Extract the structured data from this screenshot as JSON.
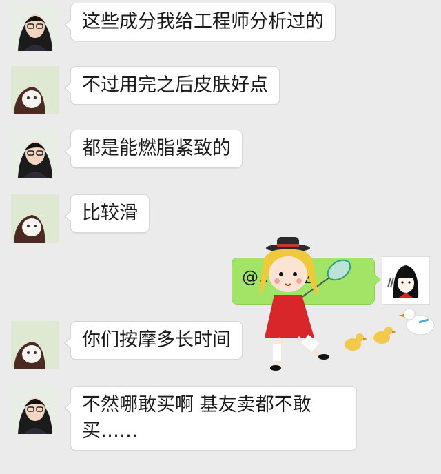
{
  "messages": [
    {
      "sender": "girl-glasses",
      "text": "这些成分我给工程师分析过的"
    },
    {
      "sender": "girl-mask",
      "text": "不过用完之后皮肤好点"
    },
    {
      "sender": "girl-glasses",
      "text": "都是能燃脂紧致的"
    },
    {
      "sender": "girl-mask",
      "text": "比较滑"
    },
    {
      "sender": "self",
      "text": "@... 专业"
    },
    {
      "sender": "girl-mask",
      "text": "你们按摩多长时间"
    },
    {
      "sender": "girl-glasses",
      "text": "不然哪敢买啊 基友卖都不敢买……"
    }
  ],
  "sticker": {
    "name": "girl-with-butterfly-net-and-ducks"
  },
  "colors": {
    "background": "#ebebeb",
    "received": "#ffffff",
    "sent": "#a2e566"
  }
}
